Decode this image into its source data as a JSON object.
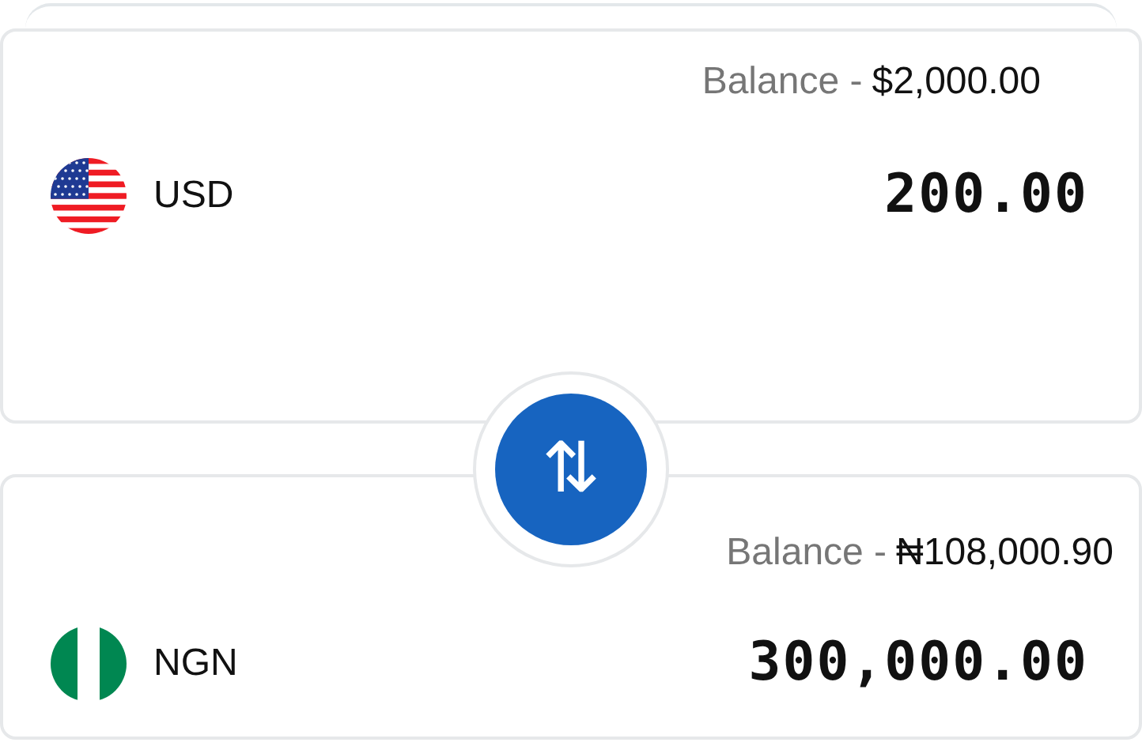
{
  "accounts": [
    {
      "kind": "usa",
      "currency": "USD",
      "balance_label": "Balance -",
      "balance": "$2,000.00",
      "amount": "200.00"
    },
    {
      "kind": "nigeria",
      "currency": "NGN",
      "balance_label": "Balance -",
      "balance": "₦108,000.90",
      "amount": "300,000.00"
    }
  ],
  "swap_button": {
    "icon": "⇅"
  }
}
